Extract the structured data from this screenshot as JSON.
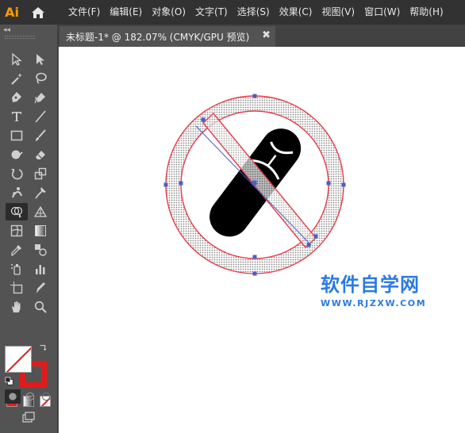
{
  "app": {
    "logo_text": "Ai"
  },
  "menu": {
    "items": [
      {
        "label": "文件(F)"
      },
      {
        "label": "编辑(E)"
      },
      {
        "label": "对象(O)"
      },
      {
        "label": "文字(T)"
      },
      {
        "label": "选择(S)"
      },
      {
        "label": "效果(C)"
      },
      {
        "label": "视图(V)"
      },
      {
        "label": "窗口(W)"
      },
      {
        "label": "帮助(H)"
      }
    ]
  },
  "document_tab": {
    "title": "未标题-1* @ 182.07% (CMYK/GPU 预览)",
    "close_symbol": "✖"
  },
  "toolbar": {
    "collapse_symbol": "◂◂",
    "tools": [
      "selection-tool-icon",
      "direct-selection-tool-icon",
      "magic-wand-tool-icon",
      "lasso-tool-icon",
      "pen-tool-icon",
      "curvature-tool-icon",
      "type-tool-icon",
      "line-segment-tool-icon",
      "rectangle-tool-icon",
      "paintbrush-tool-icon",
      "shaper-tool-icon",
      "eraser-tool-icon",
      "rotate-tool-icon",
      "scale-tool-icon",
      "puppet-warp-tool-icon",
      "free-transform-tool-icon",
      "shape-builder-tool-icon",
      "perspective-grid-tool-icon",
      "mesh-tool-icon",
      "gradient-tool-icon",
      "eyedropper-tool-icon",
      "blend-tool-icon",
      "symbol-sprayer-tool-icon",
      "column-graph-tool-icon",
      "artboard-tool-icon",
      "slice-tool-icon",
      "hand-tool-icon",
      "zoom-tool-icon"
    ],
    "fill_color": "#ffffff",
    "stroke_color": "#e31a1c"
  },
  "watermark": {
    "title": "软件自学网",
    "url": "WWW.RJZXW.COM",
    "color": "#2a7ae2"
  },
  "artwork": {
    "ring_stroke_color": "#e83a4a",
    "sandal_color": "#000000",
    "selection_color": "#4a5fc1"
  }
}
